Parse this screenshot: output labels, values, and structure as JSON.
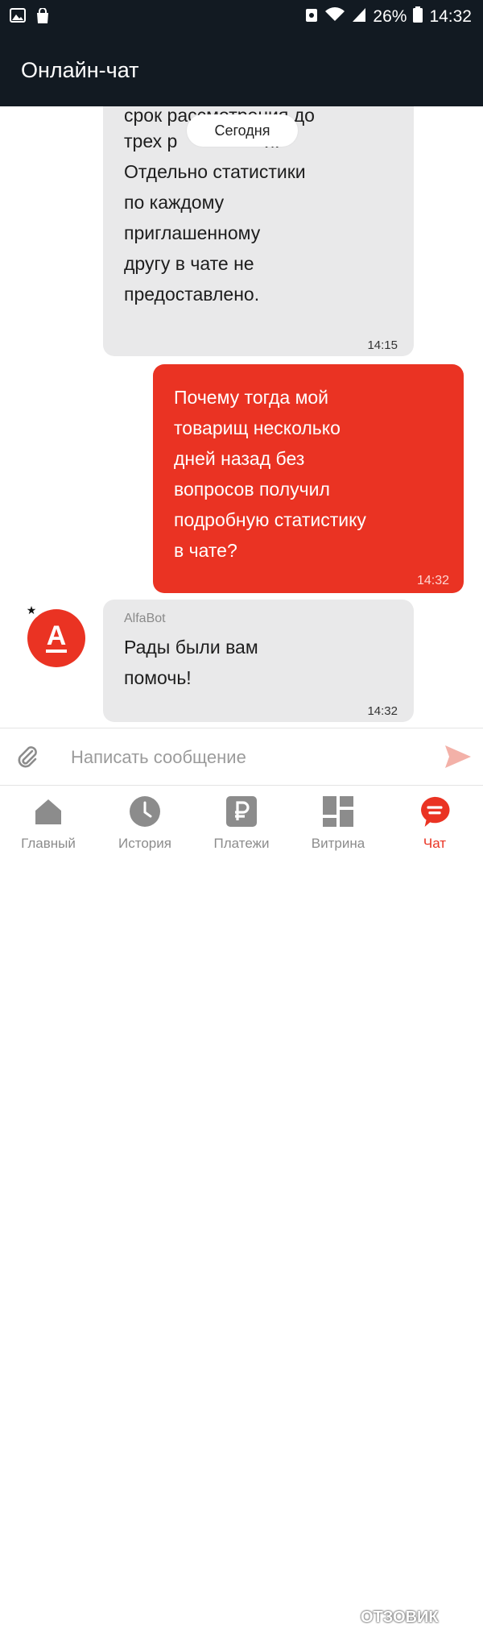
{
  "status_bar": {
    "battery_percent": "26%",
    "time": "14:32"
  },
  "header": {
    "title": "Онлайн-чат"
  },
  "chat": {
    "date_divider": "Сегодня",
    "messages": [
      {
        "sender": "support",
        "line_partial": "срок рассмотрения до",
        "line_before": "трех р",
        "line_after": "й.",
        "text_lines": [
          "Отдельно статистики",
          "по каждому",
          "приглашенному",
          "другу в чате не",
          "предоставлено."
        ],
        "time": "14:15"
      },
      {
        "sender": "me",
        "text_lines": [
          "Почему тогда мой",
          "товарищ несколько",
          "дней назад без",
          "вопросов получил",
          "подробную статистику",
          "в чате?"
        ],
        "time": "14:32"
      },
      {
        "sender": "AlfaBot",
        "author": "AlfaBot",
        "avatar_letter": "А",
        "text_lines": [
          "Рады были вам",
          "помочь!"
        ],
        "time": "14:32"
      }
    ]
  },
  "composer": {
    "placeholder": "Написать сообщение"
  },
  "tabs": [
    {
      "label": "Главный",
      "icon": "home-icon"
    },
    {
      "label": "История",
      "icon": "clock-icon"
    },
    {
      "label": "Платежи",
      "icon": "ruble-icon"
    },
    {
      "label": "Витрина",
      "icon": "showcase-icon"
    },
    {
      "label": "Чат",
      "icon": "chat-icon",
      "active": true
    }
  ],
  "watermark": "ОТЗОВИК",
  "colors": {
    "accent": "#ea3323",
    "dark_header": "#121a22",
    "bubble_in": "#e9e9ea",
    "tab_inactive": "#8c8c8c"
  }
}
